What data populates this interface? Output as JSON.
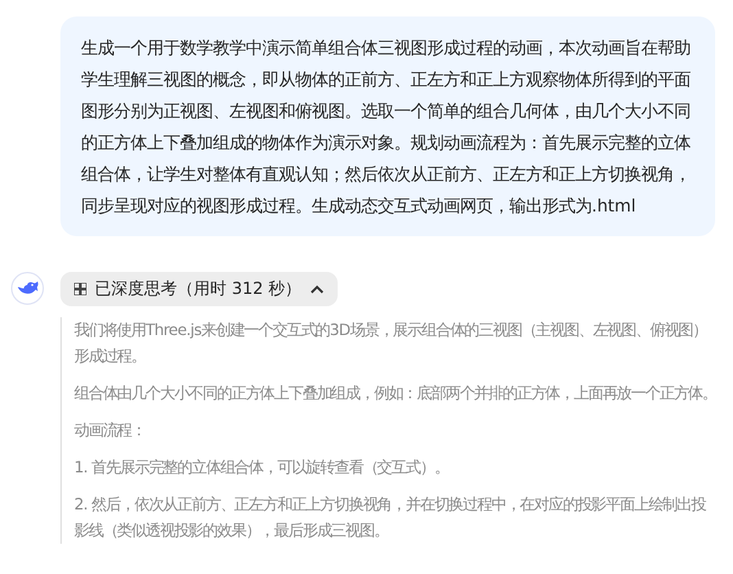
{
  "user_message": {
    "text": "生成一个用于数学教学中演示简单组合体三视图形成过程的动画，本次动画旨在帮助学生理解三视图的概念，即从物体的正前方、正左方和正上方观察物体所得到的平面图形分别为正视图、左视图和俯视图。选取一个简单的组合几何体，由几个大小不同的正方体上下叠加组成的物体作为演示对象。规划动画流程为：首先展示完整的立体组合体，让学生对整体有直观认知；然后依次从正前方、正左方和正上方切换视角，同步呈现对应的视图形成过程。生成动态交互式动画网页，输出形式为.html"
  },
  "assistant": {
    "thinking": {
      "label": "已深度思考（用时 312 秒）",
      "expanded": true,
      "paragraphs": [
        "我们将使用Three.js来创建一个交互式的3D场景，展示组合体的三视图（主视图、左视图、俯视图）形成过程。",
        "组合体由几个大小不同的正方体上下叠加组成，例如：底部两个并排的正方体，上面再放一个正方体。",
        "动画流程：",
        "1. 首先展示完整的立体组合体，可以旋转查看（交互式）。",
        "2. 然后，依次从正前方、正左方和正上方切换视角，并在切换过程中，在对应的投影平面上绘制出投影线（类似透视投影的效果），最后形成三视图。"
      ]
    }
  }
}
